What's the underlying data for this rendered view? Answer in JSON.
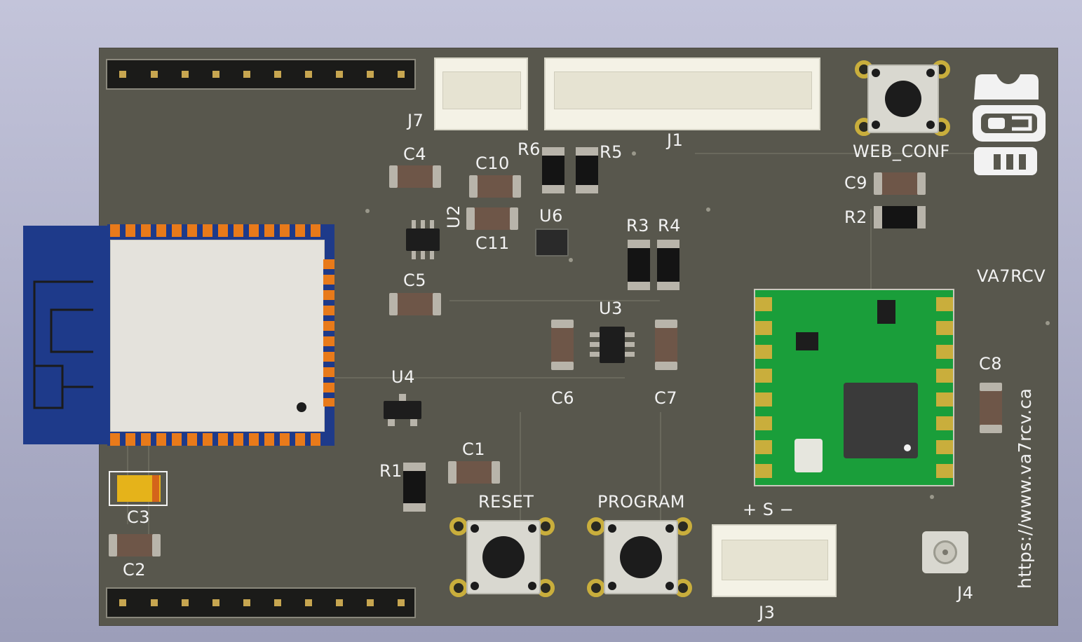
{
  "board": {
    "background_color": "#58574d",
    "silkscreen_color": "#f2f2f2",
    "module_color": "#1a9e3a",
    "antenna_color": "#1e3a8a",
    "pad_gold": "#c9ae3c"
  },
  "labels": {
    "j7": "J7",
    "j1": "J1",
    "web_conf": "WEB_CONF",
    "c4": "C4",
    "c10": "C10",
    "r6": "R6",
    "r5": "R5",
    "c9": "C9",
    "r2": "R2",
    "u2": "U2",
    "c11": "C11",
    "u6": "U6",
    "r3": "R3",
    "r4": "R4",
    "va7rcv": "VA7RCV",
    "c5": "C5",
    "u3": "U3",
    "c6": "C6",
    "c7": "C7",
    "c8": "C8",
    "u4": "U4",
    "c1": "C1",
    "r1": "R1",
    "c3": "C3",
    "c2": "C2",
    "reset": "RESET",
    "program": "PROGRAM",
    "plus_s_minus": "+ S −",
    "j3": "J3",
    "j4": "J4",
    "url": "https://www.va7rcv.ca"
  },
  "icons": {
    "logo": "robot-logo-icon",
    "antenna": "pcb-antenna-icon"
  }
}
